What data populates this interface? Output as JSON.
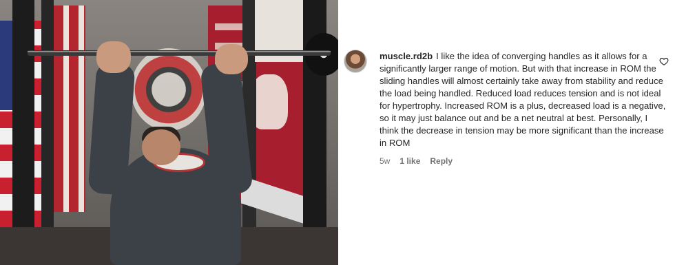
{
  "post": {
    "image_alt": "Man performing an overhead bar exercise in a gym rack"
  },
  "comment": {
    "username": "muscle.rd2b",
    "text": "I like the idea of converging handles as it allows for a significantly larger range of motion. But with that increase in ROM the sliding handles will almost certainly take away from stability and reduce the load being handled. Reduced load reduces tension and is not ideal for hypertrophy. Increased ROM is a plus, decreased load is a negative, so it may just balance out and be a net neutral at best. Personally, I think the decrease in tension may be more significant than the increase in ROM",
    "time_ago": "5w",
    "likes_label": "1 like",
    "reply_label": "Reply",
    "like_icon": "heart-outline-icon"
  },
  "colors": {
    "text_primary": "#262626",
    "text_secondary": "#737373",
    "background": "#ffffff"
  }
}
